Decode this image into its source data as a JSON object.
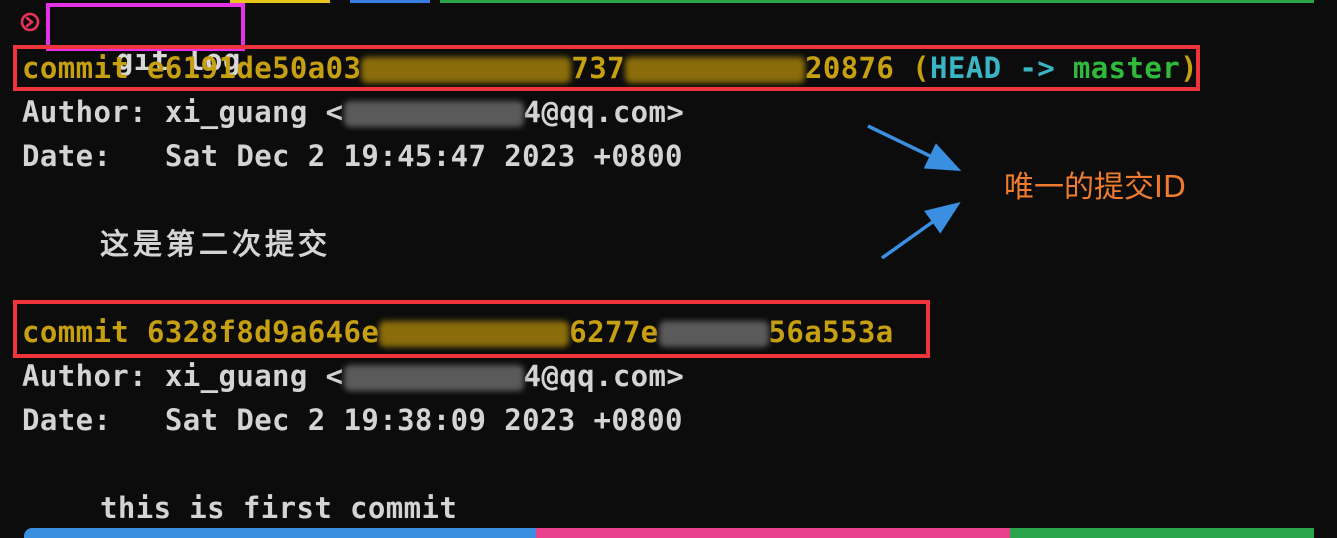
{
  "terminal": {
    "command": "git log",
    "prompt_icon": "circle-arrow-right-icon",
    "commits": [
      {
        "keyword": "commit",
        "hash_start": "e6191de50a03",
        "hash_mid": "737",
        "hash_end": "20876",
        "ref_open": " (",
        "ref_head": "HEAD",
        "ref_arrow": " -> ",
        "ref_branch": "master",
        "ref_close": ")",
        "author_label": "Author: ",
        "author_name": "xi_guang ",
        "author_email_start": "<",
        "author_email_end": "4@qq.com>",
        "date_label": "Date:   ",
        "date_value": "Sat Dec 2 19:45:47 2023 +0800",
        "message": "这是第二次提交"
      },
      {
        "keyword": "commit",
        "hash_start": "6328f8d9a646e",
        "hash_mid": "6277e",
        "hash_end": "56a553a",
        "author_label": "Author: ",
        "author_name": "xi_guang ",
        "author_email_start": "<",
        "author_email_end": "4@qq.com>",
        "date_label": "Date:   ",
        "date_value": "Sat Dec 2 19:38:09 2023 +0800",
        "message": "this is first commit"
      }
    ]
  },
  "annotation": {
    "label": "唯一的提交ID"
  },
  "colors": {
    "background": "#0c0c0c",
    "commit_hash": "#c7a012",
    "head_ref": "#3ab5c4",
    "branch_ref": "#2fba3b",
    "highlight_box_magenta": "#e632e6",
    "highlight_box_red": "#f0343c",
    "annotation_text": "#ef7b2e",
    "arrow": "#3a8fe0"
  }
}
